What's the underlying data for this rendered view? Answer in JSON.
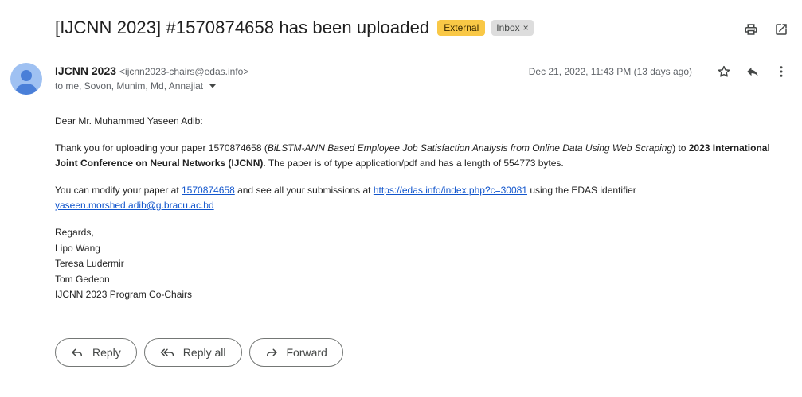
{
  "subject": "[IJCNN 2023] #1570874658 has been uploaded",
  "labels": {
    "external": "External",
    "inbox": "Inbox",
    "inbox_remove": "×"
  },
  "sender": {
    "name": "IJCNN 2023",
    "email": "<ijcnn2023-chairs@edas.info>"
  },
  "recipients": "to me, Sovon, Munim, Md, Annajiat",
  "date": "Dec 21, 2022, 11:43 PM (13 days ago)",
  "icons": {
    "print": "printer-icon",
    "popout": "open-in-new-icon",
    "star": "star-icon",
    "reply": "reply-icon",
    "more": "more-vert-icon",
    "avatar": "person-avatar-icon",
    "dropdown": "caret-down-icon",
    "reply_all": "reply-all-icon",
    "forward": "forward-icon"
  },
  "colors": {
    "external_badge": "#f9c846",
    "link": "#1155cc",
    "avatar": "#9fc1f2",
    "avatar_figure": "#4a7fd8"
  },
  "body": {
    "greeting": "Dear Mr. Muhammed Yaseen Adib:",
    "p1_prefix": "Thank you for uploading your paper 1570874658 (",
    "p1_title": "BiLSTM-ANN Based Employee Job Satisfaction Analysis from Online Data Using Web Scraping",
    "p1_mid": ") to ",
    "p1_conf": "2023 International Joint Conference on Neural Networks (IJCNN)",
    "p1_suffix": ". The paper is of type application/pdf and has a length of 554773 bytes.",
    "p2_prefix": "You can modify your paper at ",
    "p2_link1": "1570874658",
    "p2_mid": " and see all your submissions at ",
    "p2_link2": "https://edas.info/index.php?c=30081",
    "p2_mid2": " using the EDAS identifier ",
    "p2_link3": "yaseen.morshed.adib@g.bracu.ac.bd",
    "signature": [
      "Regards,",
      "Lipo Wang",
      "Teresa Ludermir",
      "Tom Gedeon",
      "IJCNN 2023 Program Co-Chairs"
    ]
  },
  "actions": {
    "reply": "Reply",
    "reply_all": "Reply all",
    "forward": "Forward"
  }
}
